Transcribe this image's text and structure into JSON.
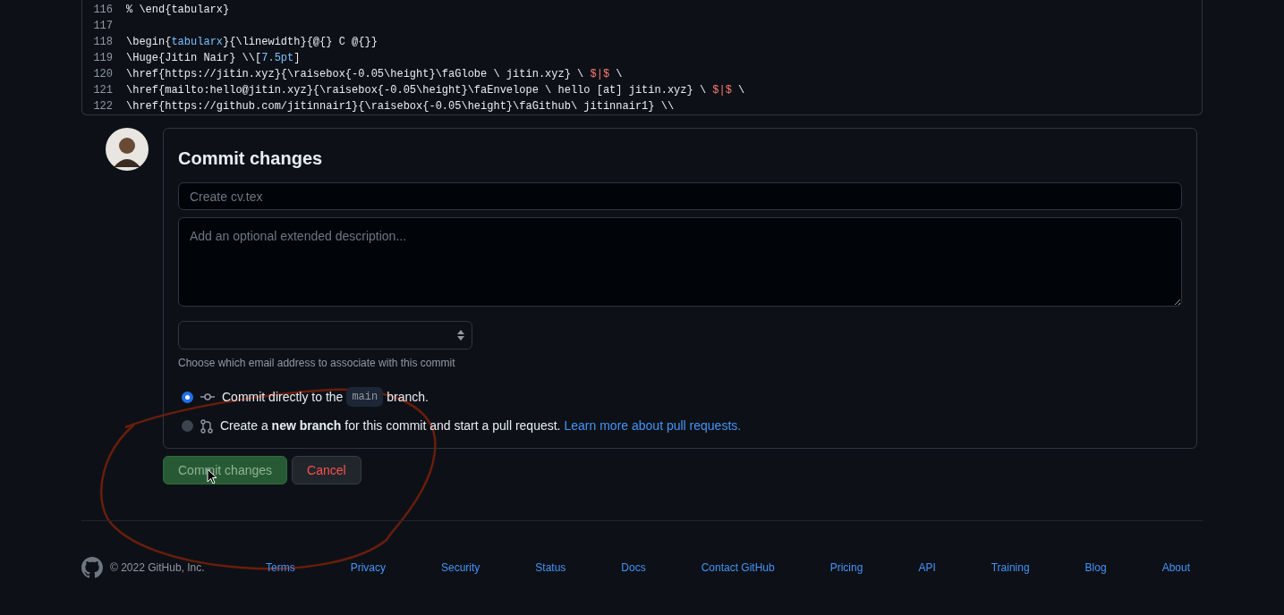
{
  "code": {
    "lines": [
      {
        "number": "116",
        "segments": [
          {
            "kind": "plain",
            "text": "% \\end{tabularx}"
          }
        ]
      },
      {
        "number": "117"
      },
      {
        "number": "118",
        "segments": [
          {
            "kind": "plain",
            "text": "\\begin{"
          },
          {
            "kind": "keyword",
            "text": "tabularx"
          },
          {
            "kind": "plain",
            "text": "}{\\linewidth}{@{} C @{}}"
          }
        ]
      },
      {
        "number": "119",
        "segments": [
          {
            "kind": "plain",
            "text": "\\Huge{Jitin Nair} \\\\["
          },
          {
            "kind": "keyword",
            "text": "7.5pt"
          },
          {
            "kind": "plain",
            "text": "]"
          }
        ]
      },
      {
        "number": "120",
        "segments": [
          {
            "kind": "plain",
            "text": "\\href{https://jitin.xyz}{\\raisebox{-0.05\\height}\\faGlobe \\ jitin.xyz} \\ "
          },
          {
            "kind": "math",
            "text": "$|$"
          },
          {
            "kind": "plain",
            "text": " \\"
          }
        ]
      },
      {
        "number": "121",
        "segments": [
          {
            "kind": "plain",
            "text": "\\href{mailto:hello@jitin.xyz}{\\raisebox{-0.05\\height}\\faEnvelope \\ hello [at] jitin.xyz} \\ "
          },
          {
            "kind": "math",
            "text": "$|$"
          },
          {
            "kind": "plain",
            "text": " \\"
          }
        ]
      },
      {
        "number": "122",
        "segments": [
          {
            "kind": "plain",
            "text": "\\href{https://github.com/jitinnair1}{\\raisebox{-0.05\\height}\\faGithub\\ jitinnair1} \\\\"
          }
        ]
      }
    ]
  },
  "commit": {
    "title": "Commit changes",
    "summary": {
      "placeholder": "Create cv.tex"
    },
    "description": {
      "placeholder": "Add an optional extended description..."
    },
    "email_hint": "Choose which email address to associate with this commit",
    "options": [
      {
        "kind": "direct",
        "selected": true,
        "parts": [
          {
            "kind": "text",
            "text": "Commit directly to the"
          },
          {
            "kind": "code",
            "text": "main"
          },
          {
            "kind": "text",
            "text": "branch."
          }
        ]
      },
      {
        "kind": "branch",
        "selected": false,
        "parts": [
          {
            "kind": "text",
            "text": "Create a **new branch** for this commit and start a pull request."
          },
          {
            "kind": "link",
            "text": "Learn more about pull requests."
          }
        ]
      }
    ],
    "buttons": [
      {
        "kind": "primary",
        "label": "Commit changes"
      },
      {
        "kind": "cancel",
        "label": "Cancel"
      }
    ]
  },
  "footer": {
    "copyright": "© 2022 GitHub, Inc.",
    "links": [
      "Terms",
      "Privacy",
      "Security",
      "Status",
      "Docs",
      "Contact GitHub",
      "Pricing",
      "API",
      "Training",
      "Blog",
      "About"
    ]
  }
}
